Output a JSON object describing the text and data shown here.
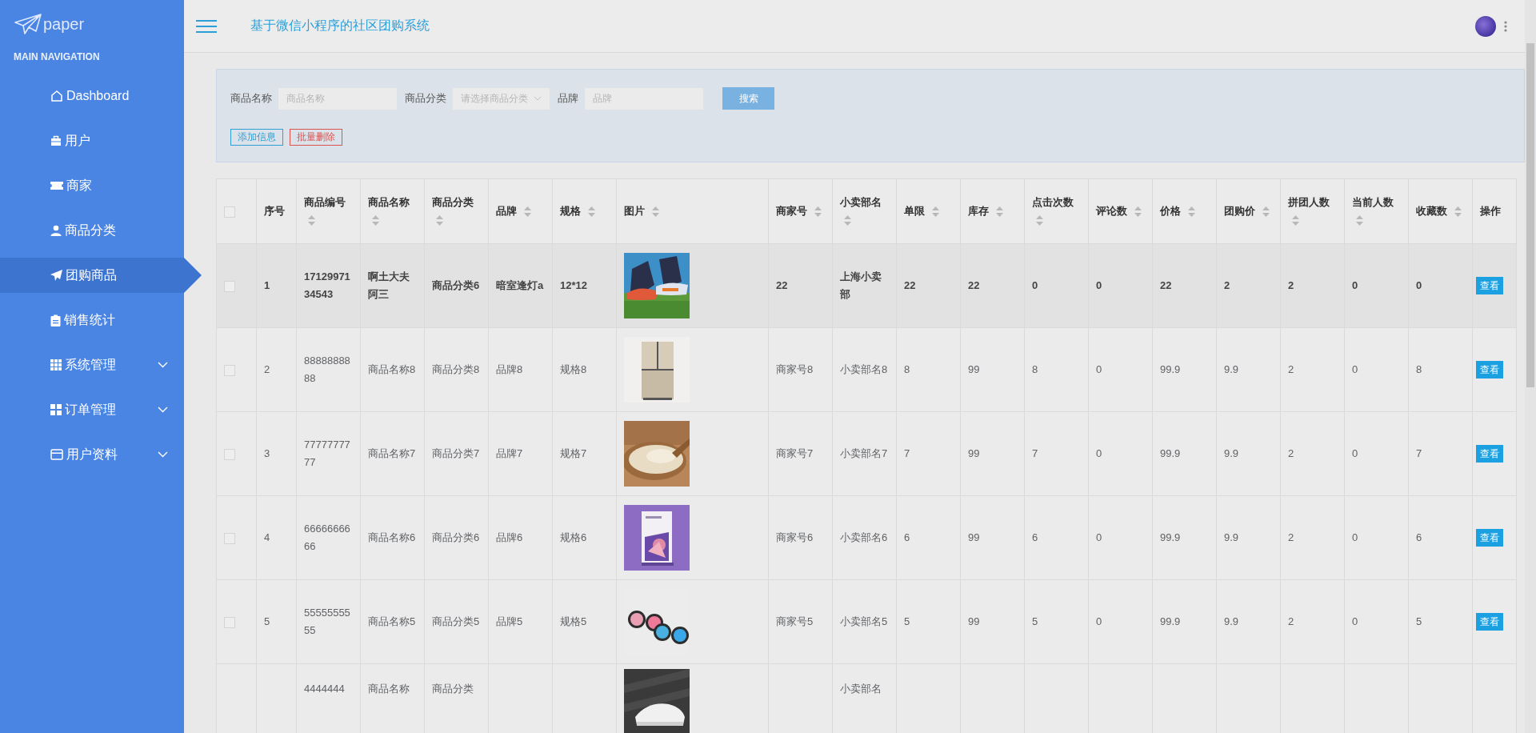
{
  "sidebar": {
    "logo": "paper",
    "section_title": "MAIN NAVIGATION",
    "items": [
      {
        "label": "Dashboard",
        "selected": false,
        "expandable": false
      },
      {
        "label": "用户",
        "selected": false,
        "expandable": false
      },
      {
        "label": "商家",
        "selected": false,
        "expandable": false
      },
      {
        "label": "商品分类",
        "selected": false,
        "expandable": false
      },
      {
        "label": "团购商品",
        "selected": true,
        "expandable": false
      },
      {
        "label": "销售统计",
        "selected": false,
        "expandable": false
      },
      {
        "label": "系统管理",
        "selected": false,
        "expandable": true
      },
      {
        "label": "订单管理",
        "selected": false,
        "expandable": true
      },
      {
        "label": "用户资料",
        "selected": false,
        "expandable": true
      }
    ]
  },
  "header": {
    "title": "基于微信小程序的社区团购系统"
  },
  "filters": {
    "fields": [
      {
        "label": "商品名称",
        "placeholder": "商品名称",
        "kind": "input"
      },
      {
        "label": "商品分类",
        "placeholder": "请选择商品分类",
        "kind": "select"
      },
      {
        "label": "品牌",
        "placeholder": "品牌",
        "kind": "input"
      }
    ],
    "search_button": "搜索",
    "add_button": "添加信息",
    "delete_button": "批量删除"
  },
  "table": {
    "columns": [
      {
        "kind": "check",
        "checked": false
      },
      {
        "kind": "text",
        "label": "序号"
      },
      {
        "kind": "text",
        "label": "商品编号",
        "sortable": true
      },
      {
        "kind": "text",
        "label": "商品名称",
        "sortable": true
      },
      {
        "kind": "text",
        "label": "商品分类",
        "sortable": true
      },
      {
        "kind": "text",
        "label": "品牌",
        "sortable": true
      },
      {
        "kind": "text",
        "label": "规格",
        "sortable": true
      },
      {
        "kind": "picture",
        "label": "图片",
        "sortable": true
      },
      {
        "kind": "text",
        "label": "商家号",
        "sortable": true
      },
      {
        "kind": "text",
        "label": "小卖部名",
        "sortable": true
      },
      {
        "kind": "text",
        "label": "单限",
        "sortable": true
      },
      {
        "kind": "text",
        "label": "库存",
        "sortable": true
      },
      {
        "kind": "text",
        "label": "点击次数",
        "sortable": true
      },
      {
        "kind": "text",
        "label": "评论数",
        "sortable": true
      },
      {
        "kind": "text",
        "label": "价格",
        "sortable": true
      },
      {
        "kind": "text",
        "label": "团购价",
        "sortable": true
      },
      {
        "kind": "text",
        "label": "拼团人数",
        "sortable": true
      },
      {
        "kind": "text",
        "label": "当前人数",
        "sortable": true
      },
      {
        "kind": "text",
        "label": "收藏数",
        "sortable": true
      },
      {
        "kind": "action",
        "label": "操作"
      }
    ],
    "rows": [
      {
        "highlighted": true,
        "cells": [
          {
            "checked": false
          },
          "1",
          "1712997134543",
          "啊土大夫阿三",
          "商品分类6",
          "暗室逢灯a",
          "12*12",
          {
            "kind": "picture"
          },
          "22",
          "上海小卖部",
          "22",
          "22",
          "0",
          "0",
          "22",
          "2",
          "2",
          "0",
          "0",
          "查看"
        ]
      },
      {
        "highlighted": false,
        "cells": [
          {
            "checked": false
          },
          "2",
          "8888888888",
          "商品名称8",
          "商品分类8",
          "品牌8",
          "规格8",
          {
            "kind": "picture"
          },
          "商家号8",
          "小卖部名8",
          "8",
          "99",
          "8",
          "0",
          "99.9",
          "9.9",
          "2",
          "0",
          "8",
          "查看"
        ]
      },
      {
        "highlighted": false,
        "cells": [
          {
            "checked": false
          },
          "3",
          "7777777777",
          "商品名称7",
          "商品分类7",
          "品牌7",
          "规格7",
          {
            "kind": "picture"
          },
          "商家号7",
          "小卖部名7",
          "7",
          "99",
          "7",
          "0",
          "99.9",
          "9.9",
          "2",
          "0",
          "7",
          "查看"
        ]
      },
      {
        "highlighted": false,
        "cells": [
          {
            "checked": false
          },
          "4",
          "6666666666",
          "商品名称6",
          "商品分类6",
          "品牌6",
          "规格6",
          {
            "kind": "picture"
          },
          "商家号6",
          "小卖部名6",
          "6",
          "99",
          "6",
          "0",
          "99.9",
          "9.9",
          "2",
          "0",
          "6",
          "查看"
        ]
      },
      {
        "highlighted": false,
        "cells": [
          {
            "checked": false
          },
          "5",
          "5555555555",
          "商品名称5",
          "商品分类5",
          "品牌5",
          "规格5",
          {
            "kind": "picture"
          },
          "商家号5",
          "小卖部名5",
          "5",
          "99",
          "5",
          "0",
          "99.9",
          "9.9",
          "2",
          "0",
          "5",
          "查看"
        ]
      },
      {
        "highlighted": false,
        "cells": [
          null,
          null,
          "4444444",
          "商品名称",
          "商品分类",
          null,
          null,
          {
            "kind": "picture"
          },
          null,
          "小卖部名",
          null,
          null,
          null,
          null,
          null,
          null,
          null,
          null,
          null,
          null
        ]
      }
    ]
  }
}
